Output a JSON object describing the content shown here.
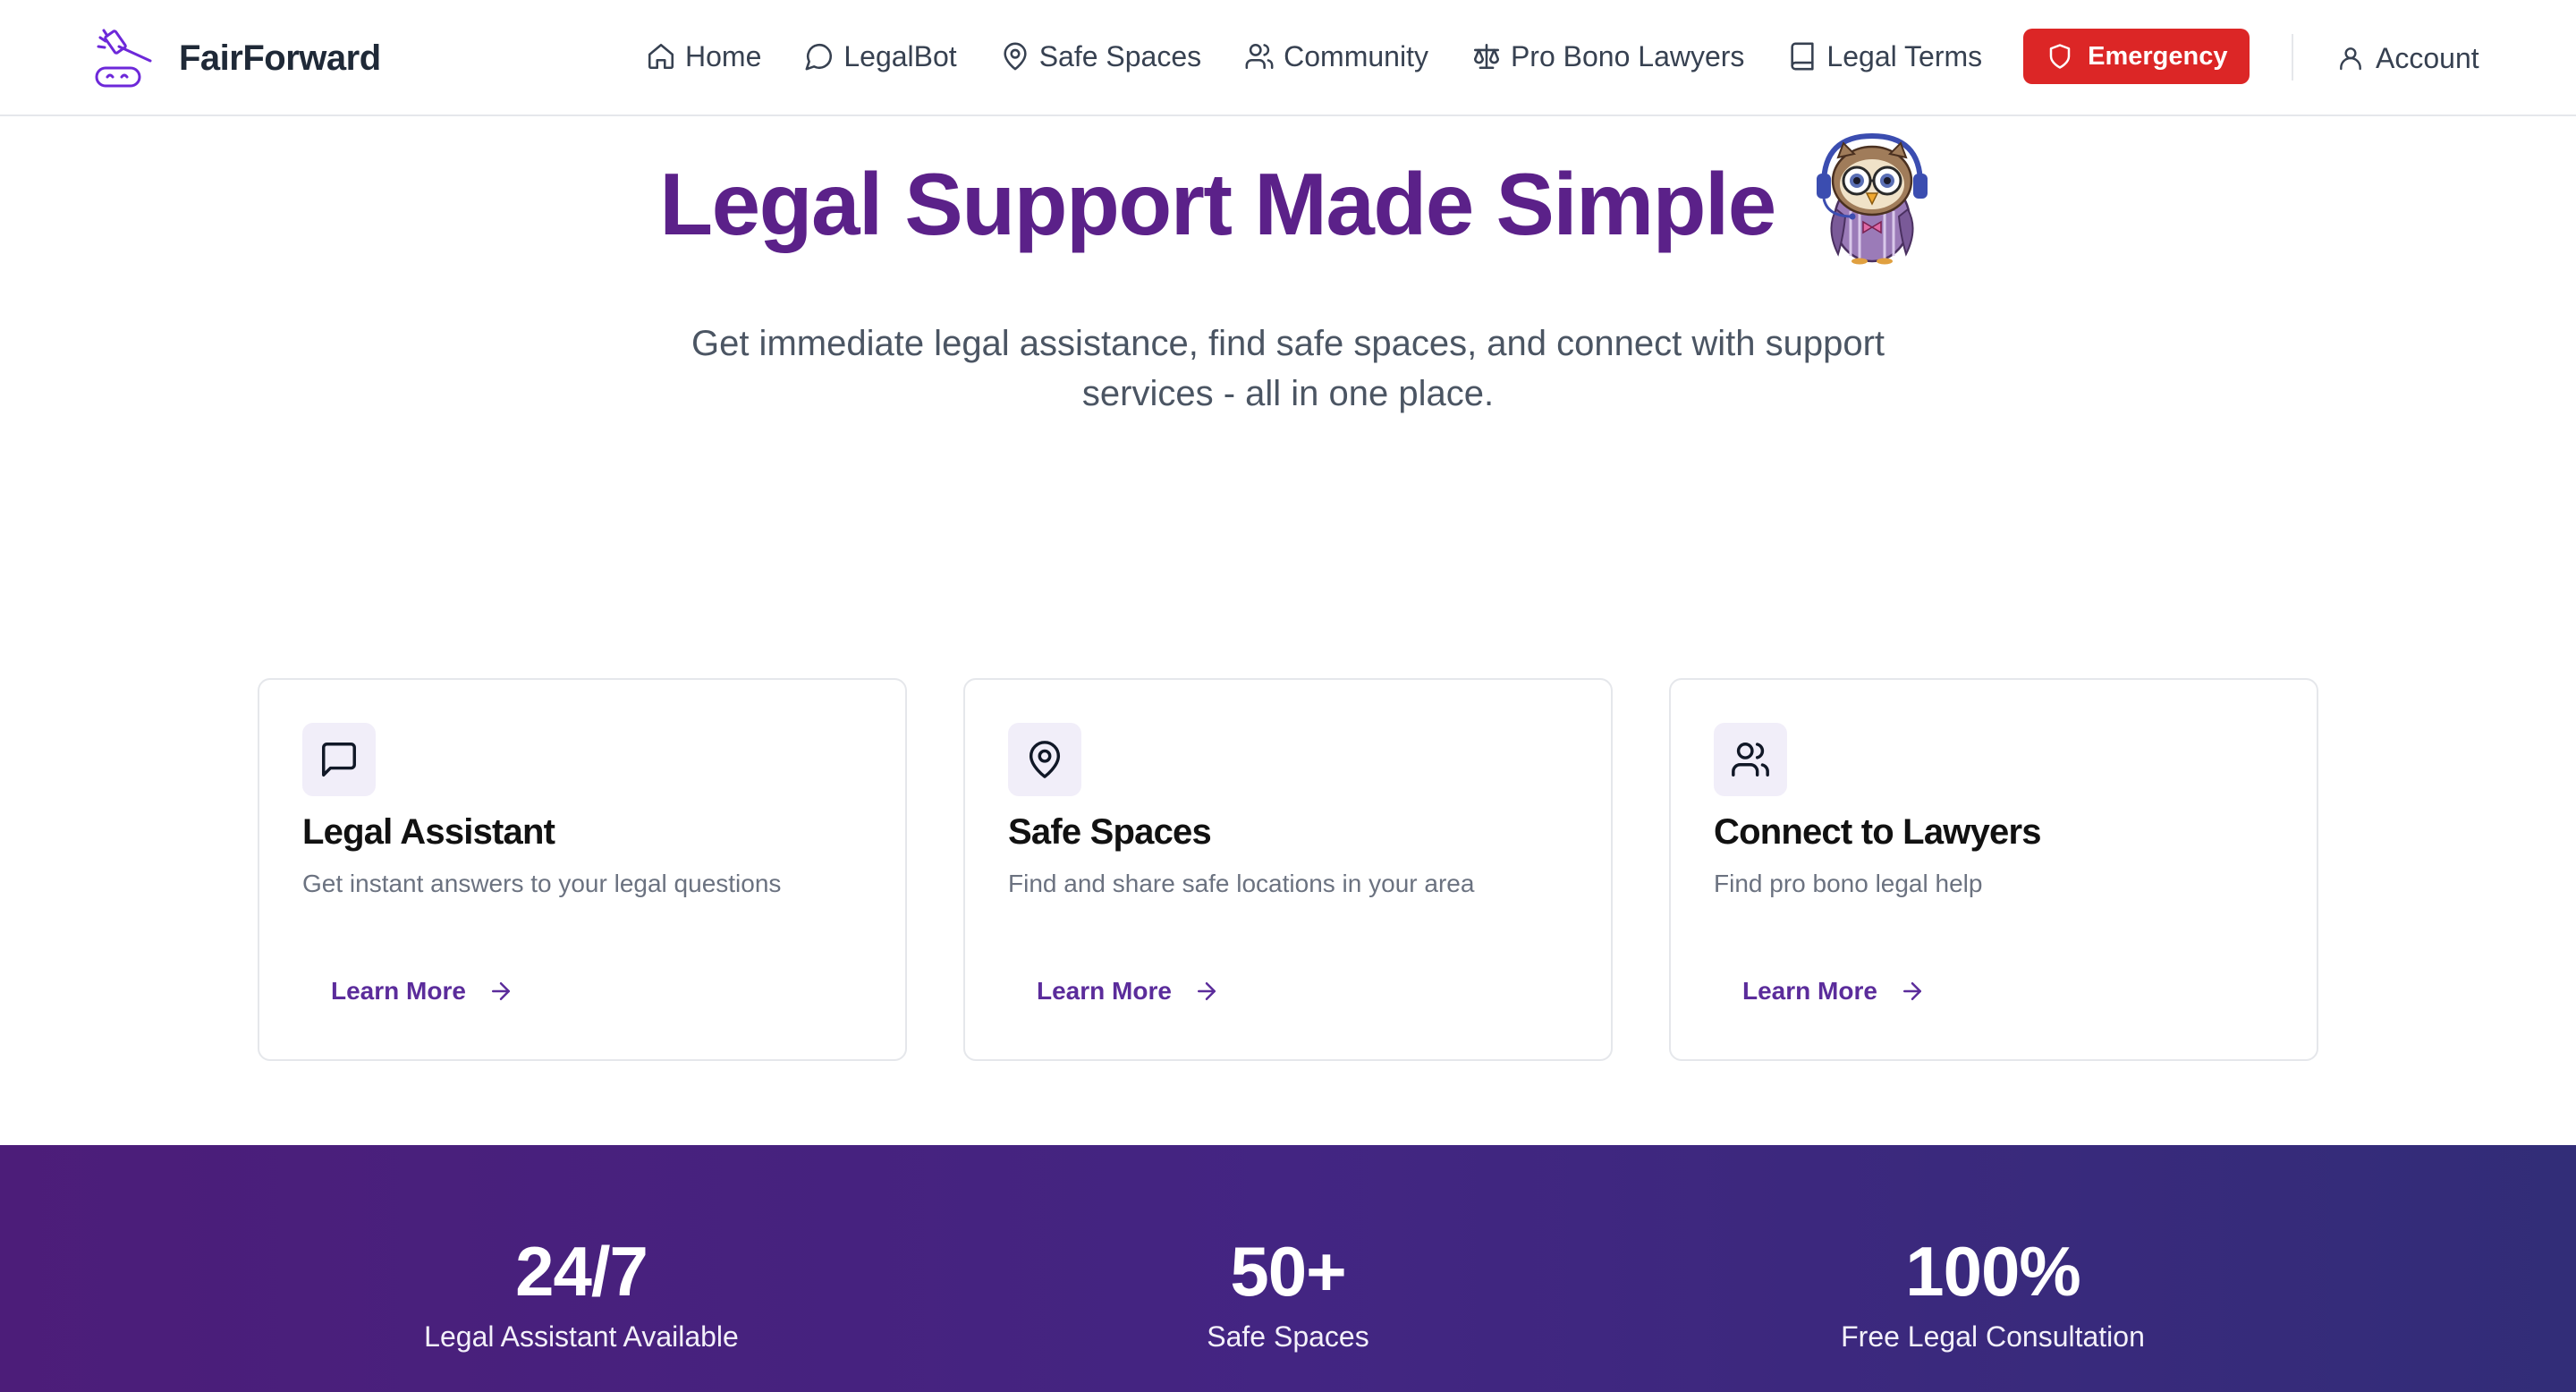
{
  "brand": {
    "name": "FairForward",
    "logo_icon": "gavel-logo-icon"
  },
  "nav": {
    "items": [
      {
        "label": "Home",
        "icon": "home-icon"
      },
      {
        "label": "LegalBot",
        "icon": "chat-bubble-icon"
      },
      {
        "label": "Safe Spaces",
        "icon": "map-pin-icon"
      },
      {
        "label": "Community",
        "icon": "users-icon"
      },
      {
        "label": "Pro Bono Lawyers",
        "icon": "scale-icon"
      },
      {
        "label": "Legal Terms",
        "icon": "book-icon"
      }
    ],
    "emergency": {
      "label": "Emergency",
      "icon": "shield-icon",
      "color": "#dc2626"
    },
    "account": {
      "label": "Account",
      "icon": "user-icon"
    }
  },
  "hero": {
    "title": "Legal Support Made Simple",
    "mascot": "owl-mascot",
    "subtitle": "Get immediate legal assistance, find safe spaces, and connect with support services - all in one place."
  },
  "features": [
    {
      "title": "Legal Assistant",
      "description": "Get instant answers to your legal questions",
      "link": "Learn More",
      "icon": "message-square-icon"
    },
    {
      "title": "Safe Spaces",
      "description": "Find and share safe locations in your area",
      "link": "Learn More",
      "icon": "map-pin-icon"
    },
    {
      "title": "Connect to Lawyers",
      "description": "Find pro bono legal help",
      "link": "Learn More",
      "icon": "users-icon"
    }
  ],
  "stats": [
    {
      "value": "24/7",
      "label": "Legal Assistant Available"
    },
    {
      "value": "50+",
      "label": "Safe Spaces"
    },
    {
      "value": "100%",
      "label": "Free Legal Consultation"
    }
  ],
  "colors": {
    "brand_purple": "#5b2189",
    "link_purple": "#5b2c9b",
    "emergency_red": "#dc2626",
    "stats_gradient_start": "#4c1d79",
    "stats_gradient_end": "#322d78"
  }
}
